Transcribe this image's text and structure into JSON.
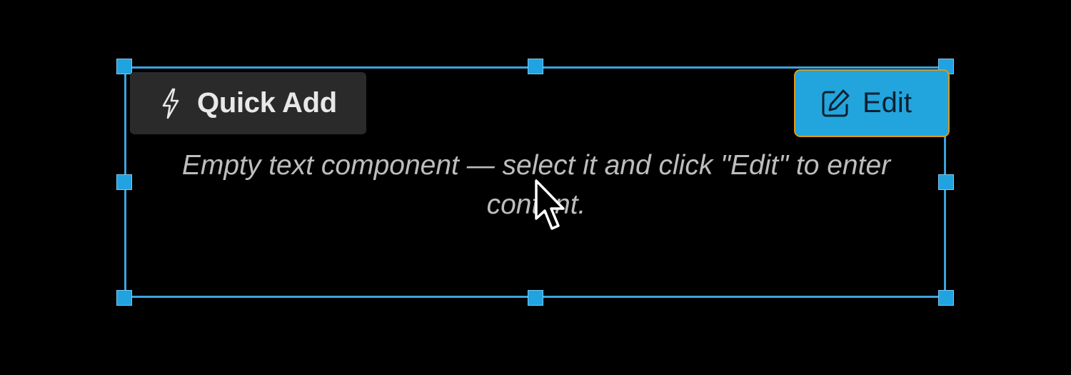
{
  "toolbar": {
    "quick_add_label": "Quick Add",
    "quick_add_icon": "lightning-bolt-icon",
    "edit_label": "Edit",
    "edit_icon": "pencil-square-icon"
  },
  "component": {
    "placeholder_text": "Empty text component — select it and click \"Edit\" to enter content."
  },
  "colors": {
    "selection_border": "#3ba3dd",
    "handle": "#20a3e0",
    "edit_button_bg": "#22a5dd",
    "edit_button_focus_ring": "#d99a1d",
    "quick_add_bg": "#2a2a2a",
    "background": "#000000"
  }
}
